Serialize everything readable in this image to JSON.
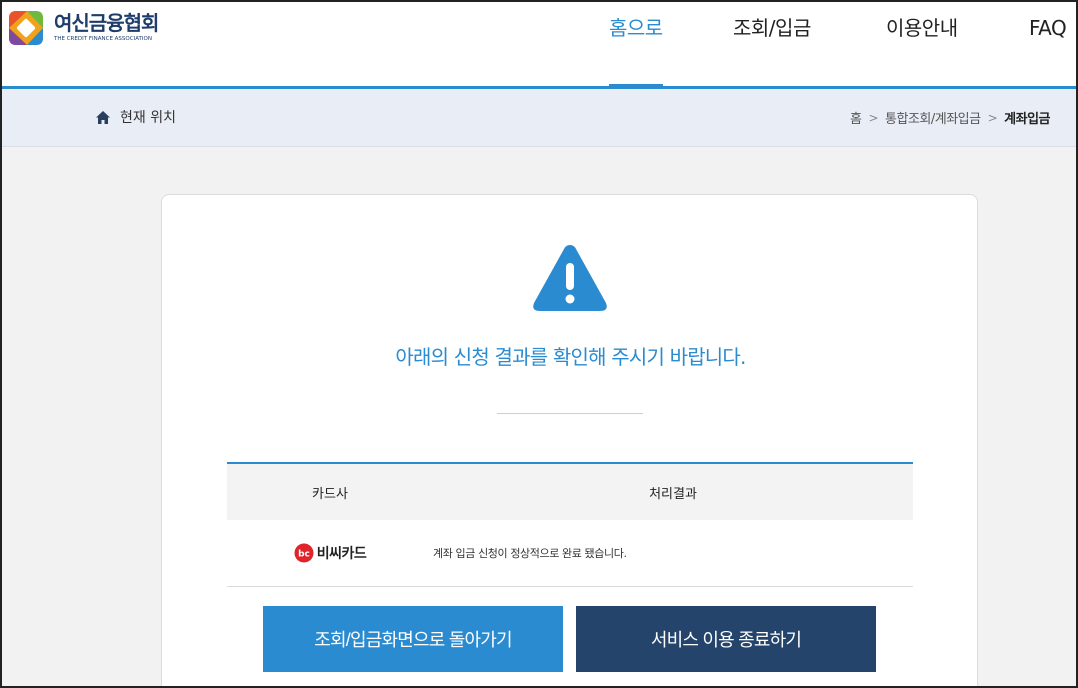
{
  "header": {
    "logo_name": "여신금융협회",
    "logo_sub": "THE CREDIT FINANCE ASSOCIATION",
    "nav": [
      {
        "label": "홈으로",
        "active": true
      },
      {
        "label": "조회/입금",
        "active": false
      },
      {
        "label": "이용안내",
        "active": false
      },
      {
        "label": "FAQ",
        "active": false
      }
    ]
  },
  "location": {
    "label": "현재 위치",
    "breadcrumbs": [
      "홈",
      "통합조회/계좌입금",
      "계좌입금"
    ]
  },
  "result": {
    "message": "아래의 신청 결과를 확인해 주시기 바랍니다.",
    "columns": [
      "카드사",
      "처리결과"
    ],
    "rows": [
      {
        "card": "비씨카드",
        "status": "계좌 입금 신청이 정상적으로 완료 됐습니다."
      }
    ]
  },
  "buttons": {
    "back": "조회/입금화면으로 돌아가기",
    "exit": "서비스 이용 종료하기"
  },
  "colors": {
    "accent": "#2a8bd0",
    "dark": "#24446b"
  },
  "icons": [
    "home-icon",
    "warning-icon",
    "bc-card-logo"
  ]
}
